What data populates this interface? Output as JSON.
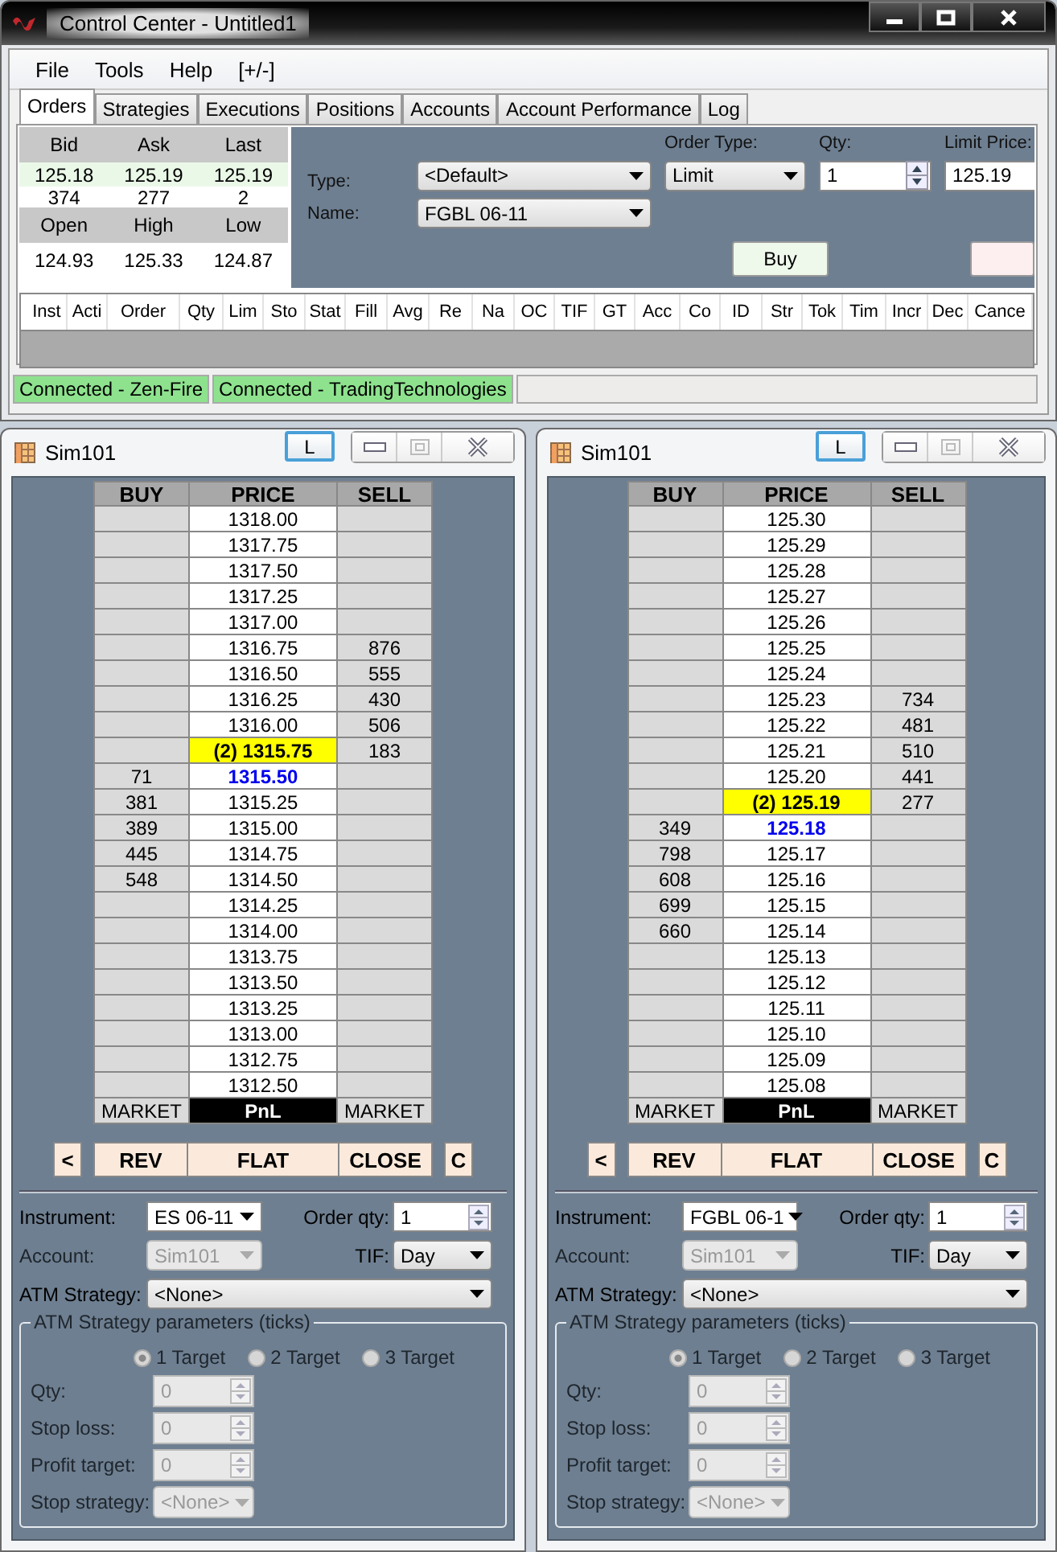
{
  "control_center": {
    "window": {
      "title": "Control Center - Untitled1"
    },
    "menu": [
      "File",
      "Tools",
      "Help",
      "[+/-]"
    ],
    "tabs": [
      {
        "label": "Orders",
        "selected": true
      },
      {
        "label": "Strategies",
        "selected": false
      },
      {
        "label": "Executions",
        "selected": false
      },
      {
        "label": "Positions",
        "selected": false
      },
      {
        "label": "Accounts",
        "selected": false
      },
      {
        "label": "Account Performance",
        "selected": false
      },
      {
        "label": "Log",
        "selected": false
      }
    ],
    "quote": {
      "header_1": [
        "Bid",
        "Ask",
        "Last"
      ],
      "prices": [
        "125.18",
        "125.19",
        "125.19"
      ],
      "sizes": [
        "374",
        "277",
        "2"
      ],
      "header_2": [
        "Open",
        "High",
        "Low"
      ],
      "session": [
        "124.93",
        "125.33",
        "124.87"
      ]
    },
    "order_entry": {
      "type_label": "Type:",
      "type_value": "<Default>",
      "name_label": "Name:",
      "name_value": "FGBL 06-11",
      "order_type_label": "Order Type:",
      "order_type_value": "Limit",
      "qty_label": "Qty:",
      "qty_value": "1",
      "limit_price_label": "Limit Price:",
      "limit_price_value": "125.19",
      "buy_button": "Buy"
    },
    "orders_grid": {
      "columns": [
        "Inst",
        "Acti",
        "Order",
        "Qty",
        "Lim",
        "Sto",
        "Stat",
        "Fill",
        "Avg",
        "Re",
        "Na",
        "OC",
        "TIF",
        "GT",
        "Acc",
        "Co",
        "ID",
        "Str",
        "Tok",
        "Tim",
        "Incr",
        "Dec",
        "Cance"
      ]
    },
    "status_bar": [
      "Connected - Zen-Fire",
      "Connected - TradingTechnologies"
    ]
  },
  "ladders": [
    {
      "title": "Sim101",
      "lock_button": "L",
      "columns": [
        "BUY",
        "PRICE",
        "SELL"
      ],
      "rows": [
        {
          "price": "1318.00",
          "kind": "normal"
        },
        {
          "price": "1317.75",
          "kind": "normal"
        },
        {
          "price": "1317.50",
          "kind": "normal"
        },
        {
          "price": "1317.25",
          "kind": "normal"
        },
        {
          "price": "1317.00",
          "kind": "normal"
        },
        {
          "price": "1316.75",
          "sell": "876",
          "kind": "normal"
        },
        {
          "price": "1316.50",
          "sell": "555",
          "kind": "normal"
        },
        {
          "price": "1316.25",
          "sell": "430",
          "kind": "normal"
        },
        {
          "price": "1316.00",
          "sell": "506",
          "kind": "normal"
        },
        {
          "price": "(2) 1315.75",
          "sell": "183",
          "kind": "last"
        },
        {
          "buy": "71",
          "price": "1315.50",
          "kind": "bid"
        },
        {
          "buy": "381",
          "price": "1315.25",
          "kind": "normal"
        },
        {
          "buy": "389",
          "price": "1315.00",
          "kind": "normal"
        },
        {
          "buy": "445",
          "price": "1314.75",
          "kind": "normal"
        },
        {
          "buy": "548",
          "price": "1314.50",
          "kind": "normal"
        },
        {
          "price": "1314.25",
          "kind": "normal"
        },
        {
          "price": "1314.00",
          "kind": "normal"
        },
        {
          "price": "1313.75",
          "kind": "normal"
        },
        {
          "price": "1313.50",
          "kind": "normal"
        },
        {
          "price": "1313.25",
          "kind": "normal"
        },
        {
          "price": "1313.00",
          "kind": "normal"
        },
        {
          "price": "1312.75",
          "kind": "normal"
        },
        {
          "price": "1312.50",
          "kind": "normal"
        }
      ],
      "footer": [
        "MARKET",
        "PnL",
        "MARKET"
      ],
      "buttons": [
        "<",
        "REV",
        "FLAT",
        "CLOSE",
        "C"
      ],
      "order_fields": [
        {
          "label": "Instrument:",
          "value": "ES 06-11",
          "kind": "combo",
          "disabled": false
        },
        {
          "label": "Order qty:",
          "value": "1",
          "kind": "spinner",
          "disabled": false
        },
        {
          "label": "Account:",
          "value": "Sim101",
          "kind": "dropdown",
          "disabled": true
        },
        {
          "label": "TIF:",
          "value": "Day",
          "kind": "dropdown",
          "disabled": false
        }
      ],
      "atm_strategy": {
        "label": "ATM Strategy:",
        "value": "<None>"
      },
      "atm_parameters": {
        "legend": "ATM Strategy parameters (ticks)",
        "targets": [
          {
            "label": "1 Target",
            "selected": true
          },
          {
            "label": "2 Target",
            "selected": false
          },
          {
            "label": "3 Target",
            "selected": false
          }
        ],
        "fields": [
          {
            "label": "Qty:",
            "value": "0",
            "kind": "spinner",
            "disabled": true
          },
          {
            "label": "Stop loss:",
            "value": "0",
            "kind": "spinner",
            "disabled": true
          },
          {
            "label": "Profit target:",
            "value": "0",
            "kind": "spinner",
            "disabled": true
          },
          {
            "label": "Stop strategy:",
            "value": "<None>",
            "kind": "dropdown",
            "disabled": true
          }
        ]
      }
    },
    {
      "title": "Sim101",
      "lock_button": "L",
      "columns": [
        "BUY",
        "PRICE",
        "SELL"
      ],
      "rows": [
        {
          "price": "125.30",
          "kind": "normal"
        },
        {
          "price": "125.29",
          "kind": "normal"
        },
        {
          "price": "125.28",
          "kind": "normal"
        },
        {
          "price": "125.27",
          "kind": "normal"
        },
        {
          "price": "125.26",
          "kind": "normal"
        },
        {
          "price": "125.25",
          "kind": "normal"
        },
        {
          "price": "125.24",
          "kind": "normal"
        },
        {
          "price": "125.23",
          "sell": "734",
          "kind": "normal"
        },
        {
          "price": "125.22",
          "sell": "481",
          "kind": "normal"
        },
        {
          "price": "125.21",
          "sell": "510",
          "kind": "normal"
        },
        {
          "price": "125.20",
          "sell": "441",
          "kind": "normal"
        },
        {
          "price": "(2) 125.19",
          "sell": "277",
          "kind": "last"
        },
        {
          "buy": "349",
          "price": "125.18",
          "kind": "bid"
        },
        {
          "buy": "798",
          "price": "125.17",
          "kind": "normal"
        },
        {
          "buy": "608",
          "price": "125.16",
          "kind": "normal"
        },
        {
          "buy": "699",
          "price": "125.15",
          "kind": "normal"
        },
        {
          "buy": "660",
          "price": "125.14",
          "kind": "normal"
        },
        {
          "price": "125.13",
          "kind": "normal"
        },
        {
          "price": "125.12",
          "kind": "normal"
        },
        {
          "price": "125.11",
          "kind": "normal"
        },
        {
          "price": "125.10",
          "kind": "normal"
        },
        {
          "price": "125.09",
          "kind": "normal"
        },
        {
          "price": "125.08",
          "kind": "normal"
        }
      ],
      "footer": [
        "MARKET",
        "PnL",
        "MARKET"
      ],
      "buttons": [
        "<",
        "REV",
        "FLAT",
        "CLOSE",
        "C"
      ],
      "order_fields": [
        {
          "label": "Instrument:",
          "value": "FGBL 06-1",
          "kind": "combo",
          "disabled": false
        },
        {
          "label": "Order qty:",
          "value": "1",
          "kind": "spinner",
          "disabled": false
        },
        {
          "label": "Account:",
          "value": "Sim101",
          "kind": "dropdown",
          "disabled": true
        },
        {
          "label": "TIF:",
          "value": "Day",
          "kind": "dropdown",
          "disabled": false
        }
      ],
      "atm_strategy": {
        "label": "ATM Strategy:",
        "value": "<None>"
      },
      "atm_parameters": {
        "legend": "ATM Strategy parameters (ticks)",
        "targets": [
          {
            "label": "1 Target",
            "selected": true
          },
          {
            "label": "2 Target",
            "selected": false
          },
          {
            "label": "3 Target",
            "selected": false
          }
        ],
        "fields": [
          {
            "label": "Qty:",
            "value": "0",
            "kind": "spinner",
            "disabled": true
          },
          {
            "label": "Stop loss:",
            "value": "0",
            "kind": "spinner",
            "disabled": true
          },
          {
            "label": "Profit target:",
            "value": "0",
            "kind": "spinner",
            "disabled": true
          },
          {
            "label": "Stop strategy:",
            "value": "<None>",
            "kind": "dropdown",
            "disabled": true
          }
        ]
      }
    }
  ]
}
